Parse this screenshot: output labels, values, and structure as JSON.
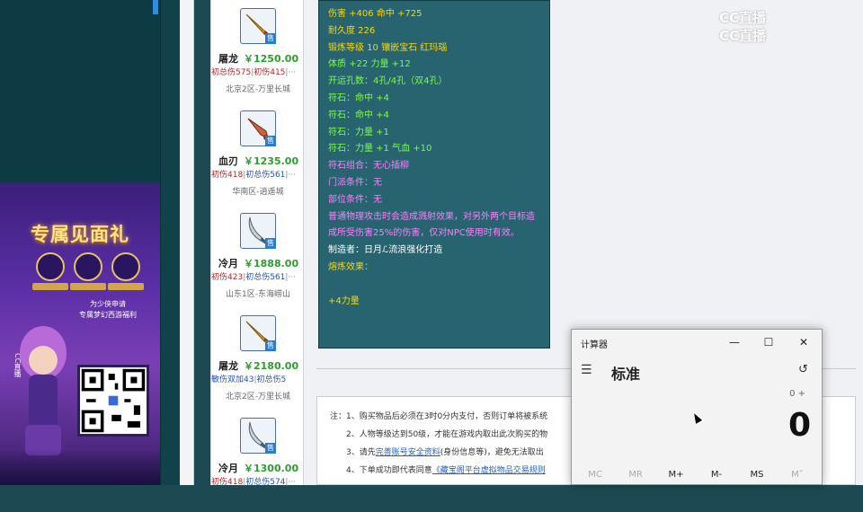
{
  "watermark": {
    "line1": "CC直播",
    "line2": "CC直播"
  },
  "promo": {
    "title": "专属见面礼",
    "subtitle1": "为少侠申请",
    "subtitle2": "专属梦幻西游福利",
    "side_text": "CC直播"
  },
  "products": [
    {
      "name": "屠龙",
      "price": "￥1250.00",
      "tag1": "初总伤575",
      "tag1_color": "red",
      "tag2": "初伤415",
      "tag2_color": "red",
      "server": "北京2区-万里长城",
      "weapon": "gold"
    },
    {
      "name": "血刃",
      "price": "￥1235.00",
      "tag1": "初伤418",
      "tag1_color": "red",
      "tag2": "初总伤561",
      "tag2_color": "blue",
      "server": "华南区-逍遥城",
      "weapon": "red"
    },
    {
      "name": "冷月",
      "price": "￥1888.00",
      "tag1": "初伤423",
      "tag1_color": "red",
      "tag2": "初总伤561",
      "tag2_color": "blue",
      "server": "山东1区-东海崂山",
      "weapon": "silver"
    },
    {
      "name": "屠龙",
      "price": "￥2180.00",
      "tag1": "敏伤双加43",
      "tag1_color": "blue",
      "tag2": "初总伤5",
      "tag2_color": "blue",
      "server": "北京2区-万里长城",
      "weapon": "gold"
    },
    {
      "name": "冷月",
      "price": "￥1300.00",
      "tag1": "初伤418",
      "tag1_color": "red",
      "tag2": "初总伤574",
      "tag2_color": "blue",
      "server": "",
      "weapon": "silver"
    }
  ],
  "tooltip": {
    "lines": [
      {
        "text": "伤害 +406 命中 +725",
        "color": "yellow"
      },
      {
        "text": "耐久度 226",
        "color": "yellow"
      },
      {
        "text": "锻炼等级 10 镶嵌宝石 红玛瑙",
        "color": "yellow"
      },
      {
        "text": "体质 +22 力量 +12",
        "color": "green"
      },
      {
        "text": "开运孔数：4孔/4孔（双4孔）",
        "color": "green"
      },
      {
        "text": "符石：命中 +4",
        "color": "green"
      },
      {
        "text": "符石：命中 +4",
        "color": "green"
      },
      {
        "text": "符石：力量 +1",
        "color": "green"
      },
      {
        "text": "符石：力量 +1 气血 +10",
        "color": "green"
      },
      {
        "text": "符石组合：无心插柳",
        "color": "pink"
      },
      {
        "text": "门派条件：无",
        "color": "pink"
      },
      {
        "text": "部位条件：无",
        "color": "pink"
      },
      {
        "text": "普通物理攻击时会造成溅射效果，对另外两个目标造成所受伤害25%的伤害，仅对NPC使用时有效。",
        "color": "pink"
      },
      {
        "text": "制造者：日月ℒ流浪强化打造",
        "color": "white"
      },
      {
        "text": "熔炼效果：",
        "color": "yellow"
      },
      {
        "text": "",
        "color": "yellow"
      },
      {
        "text": "+4力量",
        "color": "yellow"
      }
    ]
  },
  "notes": {
    "n1": "注：1、购买物品后必须在3时0分内支付，否则订单将被系统",
    "n2": "2、人物等级达到50级，才能在游戏内取出此次购买的物",
    "n3_pre": "3、请先",
    "n3_link": "完善账号安全资料",
    "n3_post": "(身份信息等)，避免无法取出",
    "n4_pre": "4、下单成功即代表同意",
    "n4_link": "《藏宝阁平台虚拟物品交易规则"
  },
  "calculator": {
    "title": "计算器",
    "mode": "标准",
    "expression": "0 +",
    "display": "0",
    "memory_buttons": [
      {
        "label": "MC",
        "enabled": false
      },
      {
        "label": "MR",
        "enabled": false
      },
      {
        "label": "M+",
        "enabled": true
      },
      {
        "label": "M-",
        "enabled": true
      },
      {
        "label": "MS",
        "enabled": true
      },
      {
        "label": "M˅",
        "enabled": false
      }
    ]
  },
  "colors": {
    "price_green": "#2d9d2d",
    "tooltip_bg": "#276470",
    "link_blue": "#2060c0"
  }
}
